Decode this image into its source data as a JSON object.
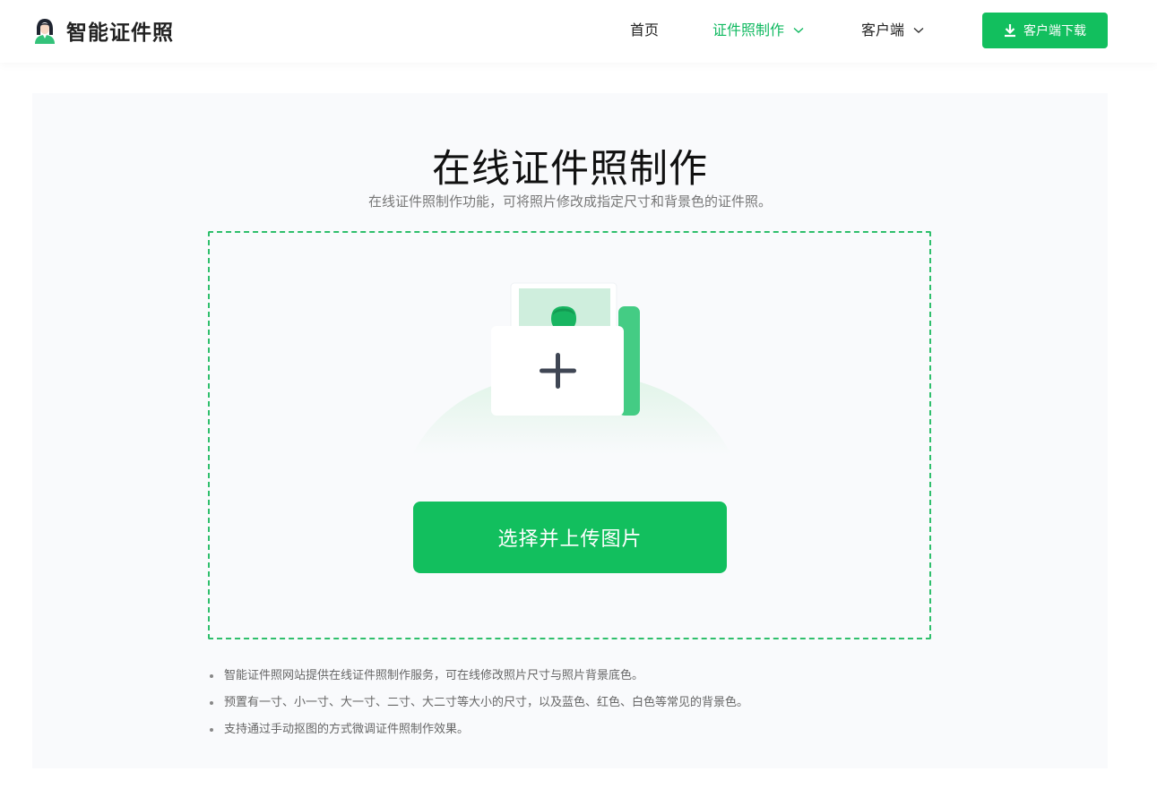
{
  "header": {
    "logo_text": "智能证件照",
    "nav": {
      "home": "首页",
      "make": "证件照制作",
      "client": "客户端"
    },
    "download_label": "客户端下载"
  },
  "main": {
    "title": "在线证件照制作",
    "subtitle": "在线证件照制作功能，可将照片修改成指定尺寸和背景色的证件照。",
    "upload_label": "选择并上传图片",
    "notes": [
      "智能证件照网站提供在线证件照制作服务，可在线修改照片尺寸与照片背景底色。",
      "预置有一寸、小一寸、大一寸、二寸、大二寸等大小的尺寸，以及蓝色、红色、白色等常见的背景色。",
      "支持通过手动抠图的方式微调证件照制作效果。"
    ]
  },
  "colors": {
    "accent": "#12bf5e",
    "card_bg": "#f9fafc",
    "dash_border": "#2fbf6c"
  },
  "icons": [
    "logo-avatar-icon",
    "chevron-down-icon",
    "download-icon",
    "plus-icon",
    "id-photo-person-icon"
  ]
}
